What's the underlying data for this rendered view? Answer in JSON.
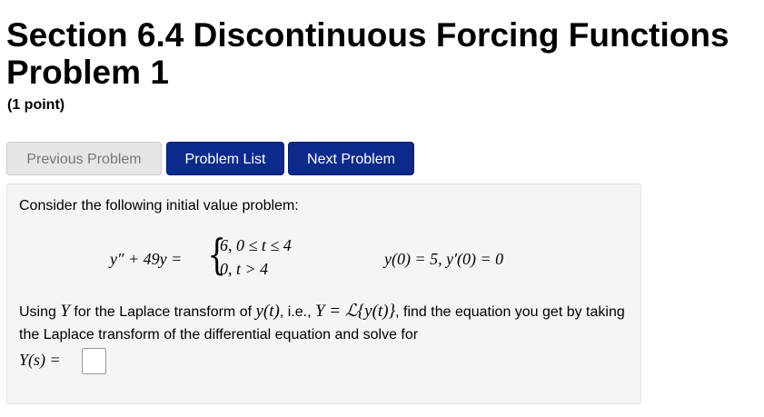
{
  "header": {
    "title_line1": "Section 6.4 Discontinuous Forcing Functions",
    "title_line2": "Problem 1",
    "points": "(1 point)"
  },
  "nav": {
    "previous_label": "Previous Problem",
    "list_label": "Problem List",
    "next_label": "Next Problem"
  },
  "problem": {
    "intro": "Consider the following initial value problem:",
    "ode_lhs": "y″ + 49y =",
    "case1": "6,   0 ≤ t ≤ 4",
    "case2": "0,   t > 4",
    "initial_conditions": "y(0) = 5,  y′(0) = 0",
    "para_part1": "Using ",
    "para_Y": "Y",
    "para_part2": " for the Laplace transform of ",
    "para_yt": "y(t)",
    "para_part3": ", i.e., ",
    "para_def": "Y = ℒ{y(t)}",
    "para_part4": ", find the equation you get by taking the Laplace transform of the differential equation and solve for",
    "answer_label": "Y(s) =",
    "answer_value": ""
  }
}
